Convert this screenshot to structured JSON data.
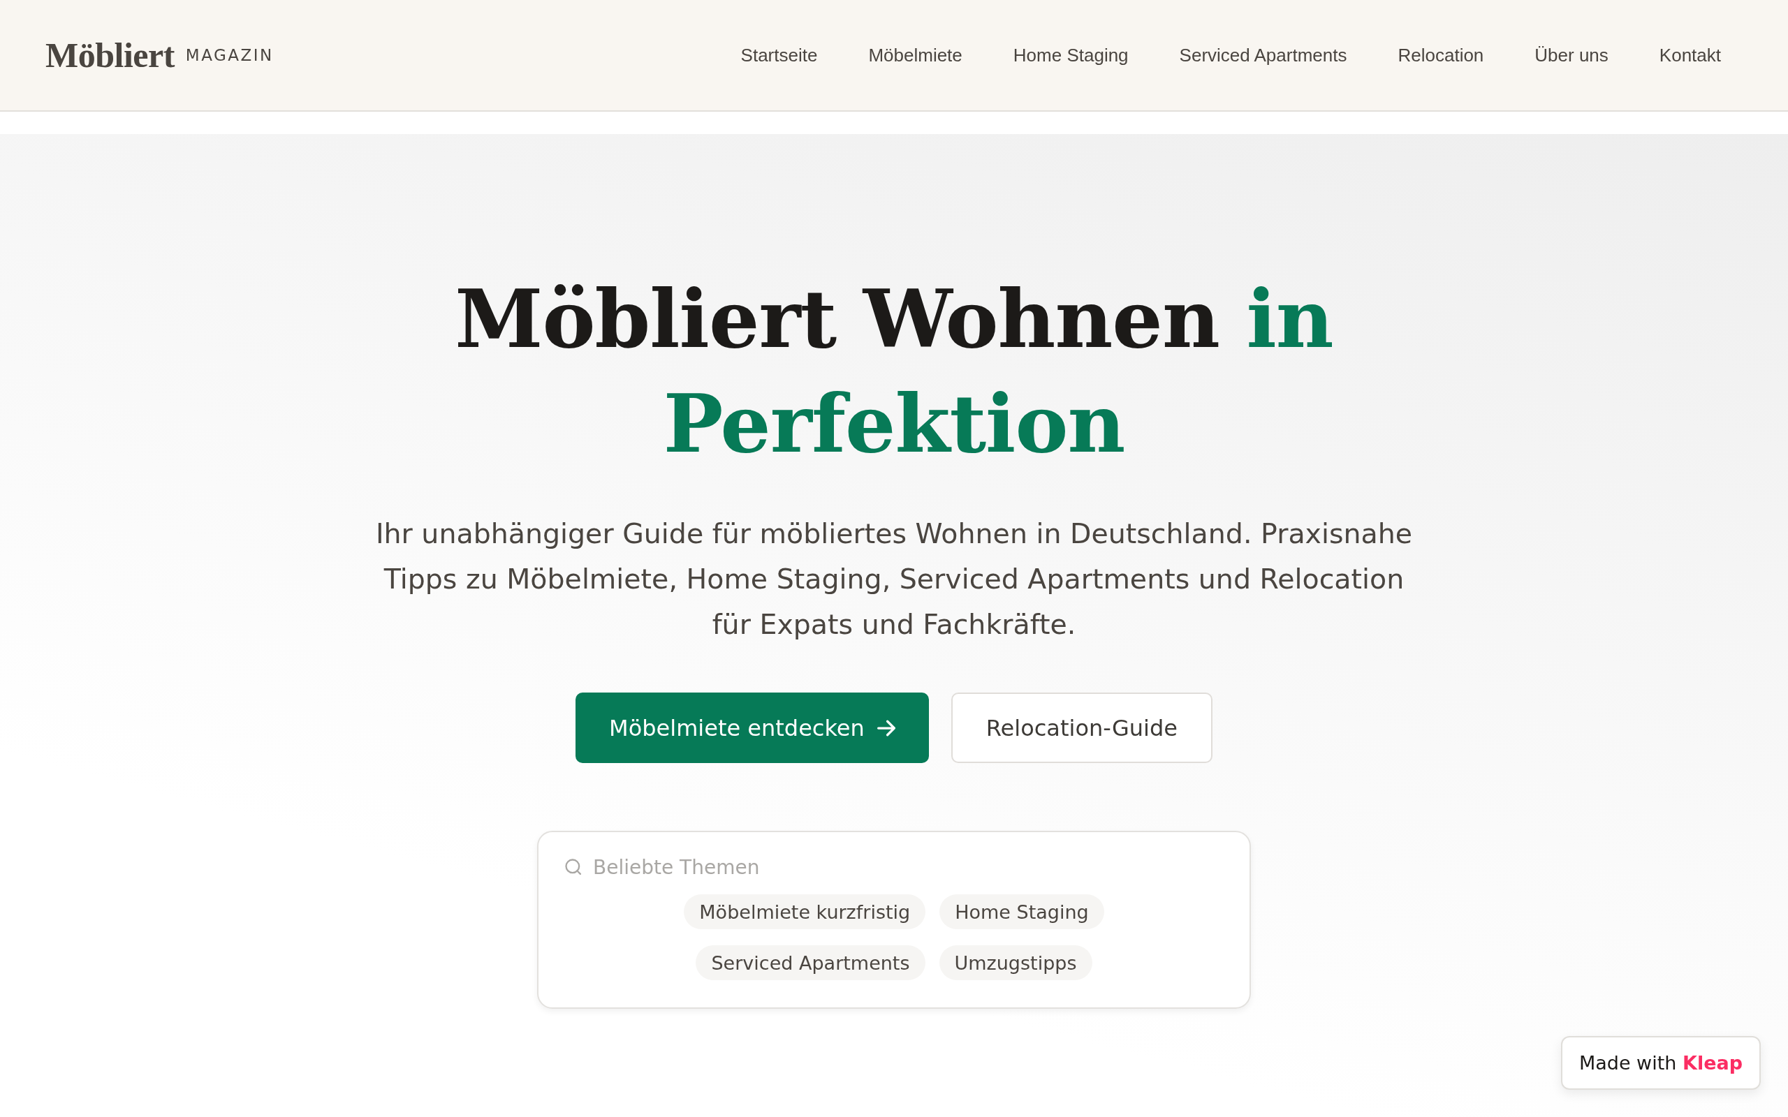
{
  "header": {
    "logo": "Möbliert",
    "logo_tag": "MAGAZIN",
    "nav": [
      "Startseite",
      "Möbelmiete",
      "Home Staging",
      "Serviced Apartments",
      "Relocation",
      "Über uns",
      "Kontakt"
    ]
  },
  "hero": {
    "title": "Möbliert Wohnen",
    "title_accent": "in Perfektion",
    "lead": "Ihr unabhängiger Guide für möbliertes Wohnen in Deutschland. Praxisnahe Tipps zu Möbelmiete, Home Staging, Serviced Apartments und Relocation für Expats und Fachkräfte.",
    "buttons": [
      {
        "label": "Möbelmiete entdecken",
        "kind": "primary"
      },
      {
        "label": "Relocation-Guide",
        "kind": "secondary"
      }
    ]
  },
  "topics": {
    "placeholder": "Beliebte Themen",
    "tags": [
      "Möbelmiete kurzfristig",
      "Home Staging",
      "Serviced Apartments",
      "Umzugstipps"
    ]
  },
  "badge": {
    "text": "Made with **Kleap**"
  }
}
